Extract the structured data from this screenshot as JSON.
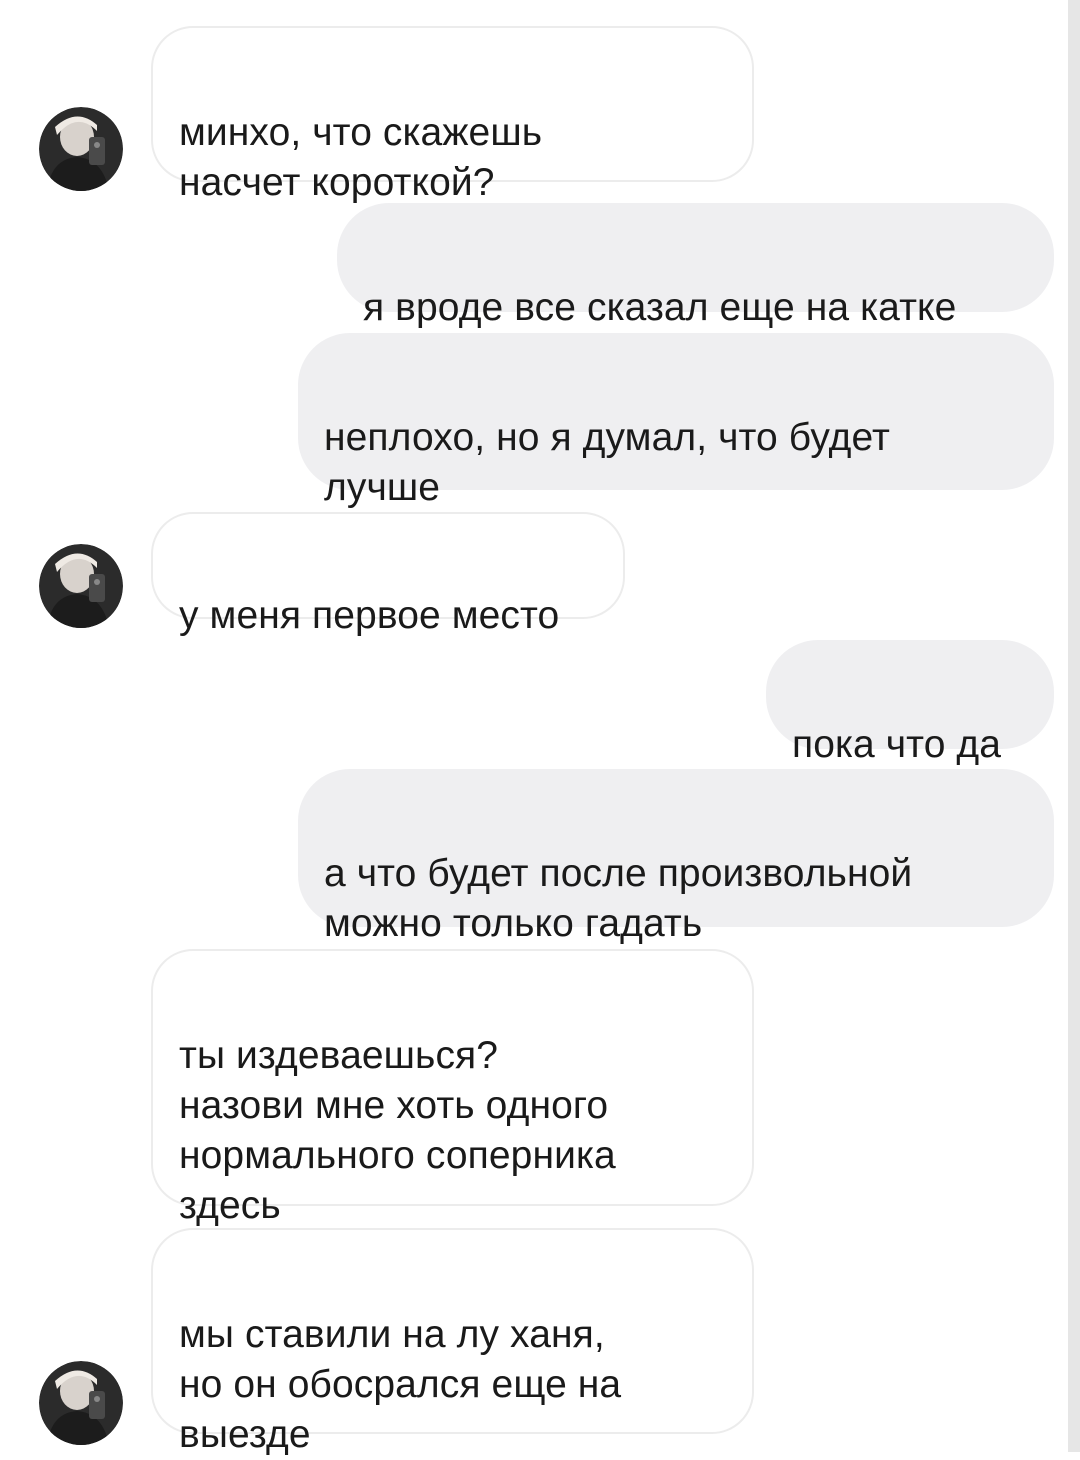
{
  "messages": [
    {
      "direction": "incoming",
      "text": "минхо, что скажешь\nнасчет короткой?",
      "avatar": "contact-avatar-photo"
    },
    {
      "direction": "outgoing",
      "text": "я вроде все сказал еще на катке"
    },
    {
      "direction": "outgoing",
      "text": "неплохо, но я думал, что будет\nлучше"
    },
    {
      "direction": "incoming",
      "text": "у меня первое место",
      "avatar": "contact-avatar-photo"
    },
    {
      "direction": "outgoing",
      "text": "пока что да"
    },
    {
      "direction": "outgoing",
      "text": "а что будет после произвольной\nможно только гадать"
    },
    {
      "direction": "incoming",
      "text": "ты издеваешься?\nназови мне хоть одного\nнормального соперника\nздесь"
    },
    {
      "direction": "incoming",
      "text": "мы ставили на лу ханя,\nно он обосрался еще на\nвыезде",
      "avatar": "contact-avatar-photo"
    }
  ],
  "colors": {
    "incoming_bubble": "#ffffff",
    "incoming_border": "#ececec",
    "outgoing_bubble": "#efeff1",
    "text": "#1a1a1a"
  }
}
